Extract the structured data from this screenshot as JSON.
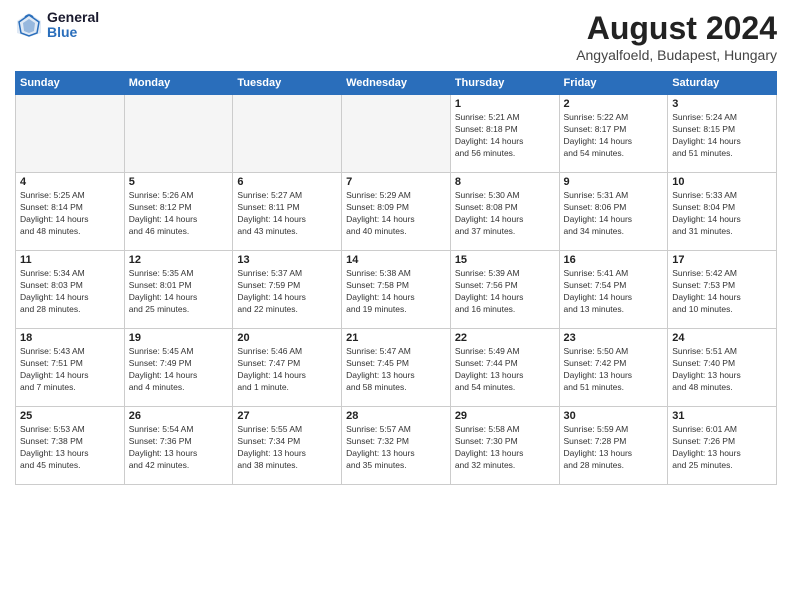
{
  "logo": {
    "general": "General",
    "blue": "Blue"
  },
  "header": {
    "month_year": "August 2024",
    "location": "Angyalfoeld, Budapest, Hungary"
  },
  "days_of_week": [
    "Sunday",
    "Monday",
    "Tuesday",
    "Wednesday",
    "Thursday",
    "Friday",
    "Saturday"
  ],
  "weeks": [
    [
      {
        "day": "",
        "info": "",
        "empty": true
      },
      {
        "day": "",
        "info": "",
        "empty": true
      },
      {
        "day": "",
        "info": "",
        "empty": true
      },
      {
        "day": "",
        "info": "",
        "empty": true
      },
      {
        "day": "1",
        "info": "Sunrise: 5:21 AM\nSunset: 8:18 PM\nDaylight: 14 hours\nand 56 minutes."
      },
      {
        "day": "2",
        "info": "Sunrise: 5:22 AM\nSunset: 8:17 PM\nDaylight: 14 hours\nand 54 minutes."
      },
      {
        "day": "3",
        "info": "Sunrise: 5:24 AM\nSunset: 8:15 PM\nDaylight: 14 hours\nand 51 minutes."
      }
    ],
    [
      {
        "day": "4",
        "info": "Sunrise: 5:25 AM\nSunset: 8:14 PM\nDaylight: 14 hours\nand 48 minutes."
      },
      {
        "day": "5",
        "info": "Sunrise: 5:26 AM\nSunset: 8:12 PM\nDaylight: 14 hours\nand 46 minutes."
      },
      {
        "day": "6",
        "info": "Sunrise: 5:27 AM\nSunset: 8:11 PM\nDaylight: 14 hours\nand 43 minutes."
      },
      {
        "day": "7",
        "info": "Sunrise: 5:29 AM\nSunset: 8:09 PM\nDaylight: 14 hours\nand 40 minutes."
      },
      {
        "day": "8",
        "info": "Sunrise: 5:30 AM\nSunset: 8:08 PM\nDaylight: 14 hours\nand 37 minutes."
      },
      {
        "day": "9",
        "info": "Sunrise: 5:31 AM\nSunset: 8:06 PM\nDaylight: 14 hours\nand 34 minutes."
      },
      {
        "day": "10",
        "info": "Sunrise: 5:33 AM\nSunset: 8:04 PM\nDaylight: 14 hours\nand 31 minutes."
      }
    ],
    [
      {
        "day": "11",
        "info": "Sunrise: 5:34 AM\nSunset: 8:03 PM\nDaylight: 14 hours\nand 28 minutes."
      },
      {
        "day": "12",
        "info": "Sunrise: 5:35 AM\nSunset: 8:01 PM\nDaylight: 14 hours\nand 25 minutes."
      },
      {
        "day": "13",
        "info": "Sunrise: 5:37 AM\nSunset: 7:59 PM\nDaylight: 14 hours\nand 22 minutes."
      },
      {
        "day": "14",
        "info": "Sunrise: 5:38 AM\nSunset: 7:58 PM\nDaylight: 14 hours\nand 19 minutes."
      },
      {
        "day": "15",
        "info": "Sunrise: 5:39 AM\nSunset: 7:56 PM\nDaylight: 14 hours\nand 16 minutes."
      },
      {
        "day": "16",
        "info": "Sunrise: 5:41 AM\nSunset: 7:54 PM\nDaylight: 14 hours\nand 13 minutes."
      },
      {
        "day": "17",
        "info": "Sunrise: 5:42 AM\nSunset: 7:53 PM\nDaylight: 14 hours\nand 10 minutes."
      }
    ],
    [
      {
        "day": "18",
        "info": "Sunrise: 5:43 AM\nSunset: 7:51 PM\nDaylight: 14 hours\nand 7 minutes."
      },
      {
        "day": "19",
        "info": "Sunrise: 5:45 AM\nSunset: 7:49 PM\nDaylight: 14 hours\nand 4 minutes."
      },
      {
        "day": "20",
        "info": "Sunrise: 5:46 AM\nSunset: 7:47 PM\nDaylight: 14 hours\nand 1 minute."
      },
      {
        "day": "21",
        "info": "Sunrise: 5:47 AM\nSunset: 7:45 PM\nDaylight: 13 hours\nand 58 minutes."
      },
      {
        "day": "22",
        "info": "Sunrise: 5:49 AM\nSunset: 7:44 PM\nDaylight: 13 hours\nand 54 minutes."
      },
      {
        "day": "23",
        "info": "Sunrise: 5:50 AM\nSunset: 7:42 PM\nDaylight: 13 hours\nand 51 minutes."
      },
      {
        "day": "24",
        "info": "Sunrise: 5:51 AM\nSunset: 7:40 PM\nDaylight: 13 hours\nand 48 minutes."
      }
    ],
    [
      {
        "day": "25",
        "info": "Sunrise: 5:53 AM\nSunset: 7:38 PM\nDaylight: 13 hours\nand 45 minutes."
      },
      {
        "day": "26",
        "info": "Sunrise: 5:54 AM\nSunset: 7:36 PM\nDaylight: 13 hours\nand 42 minutes."
      },
      {
        "day": "27",
        "info": "Sunrise: 5:55 AM\nSunset: 7:34 PM\nDaylight: 13 hours\nand 38 minutes."
      },
      {
        "day": "28",
        "info": "Sunrise: 5:57 AM\nSunset: 7:32 PM\nDaylight: 13 hours\nand 35 minutes."
      },
      {
        "day": "29",
        "info": "Sunrise: 5:58 AM\nSunset: 7:30 PM\nDaylight: 13 hours\nand 32 minutes."
      },
      {
        "day": "30",
        "info": "Sunrise: 5:59 AM\nSunset: 7:28 PM\nDaylight: 13 hours\nand 28 minutes."
      },
      {
        "day": "31",
        "info": "Sunrise: 6:01 AM\nSunset: 7:26 PM\nDaylight: 13 hours\nand 25 minutes."
      }
    ]
  ]
}
